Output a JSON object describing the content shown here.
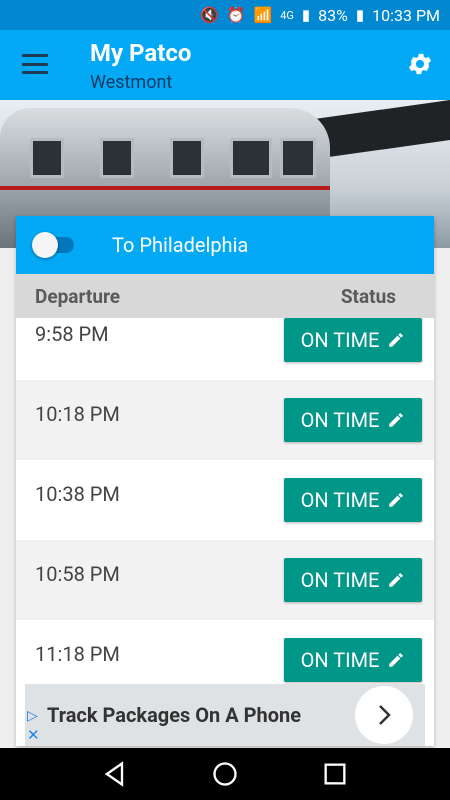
{
  "status_bar": {
    "battery": "83%",
    "time": "10:33 PM",
    "network": "4G"
  },
  "app_bar": {
    "title": "My Patco",
    "subtitle": "Westmont"
  },
  "direction_card": {
    "direction_label": "To Philadelphia",
    "toggle_on": false,
    "column_departure": "Departure",
    "column_status": "Status",
    "rows": [
      {
        "time": "9:58 PM",
        "status": "ON TIME"
      },
      {
        "time": "10:18 PM",
        "status": "ON TIME"
      },
      {
        "time": "10:38 PM",
        "status": "ON TIME"
      },
      {
        "time": "10:58 PM",
        "status": "ON TIME"
      },
      {
        "time": "11:18 PM",
        "status": "ON TIME"
      }
    ]
  },
  "ad": {
    "text": "Track Packages On A Phone"
  },
  "colors": {
    "app_bar": "#03a9f4",
    "status_bar": "#0288d1",
    "status_button": "#009688"
  }
}
